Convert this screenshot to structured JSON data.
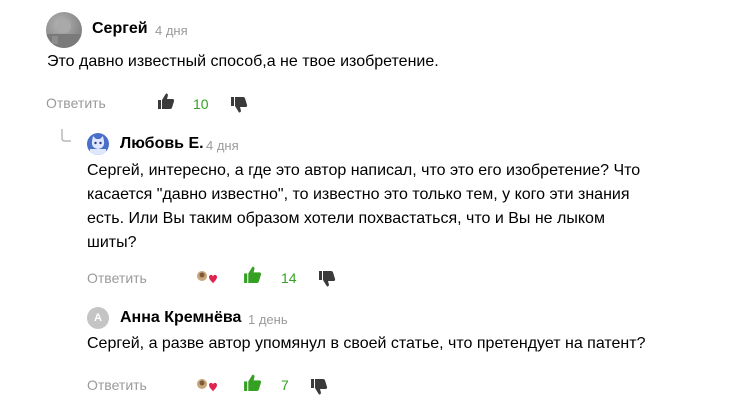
{
  "comments": [
    {
      "author": "Сергей",
      "date": "4 дня",
      "text": "Это давно известный способ,а не твое изобретение.",
      "reply_label": "Ответить",
      "likes": "10"
    },
    {
      "author": "Любовь Е.",
      "date": "4 дня",
      "text": "Сергей, интересно, а где это автор написал, что это его изобретение? Что касается \"давно известно\", то известно это только тем, у кого эти знания есть. Или Вы таким образом хотели похвастаться, что и Вы не лыком шиты?",
      "reply_label": "Ответить",
      "likes": "14"
    },
    {
      "author": "Анна Кремнёва",
      "avatar_letter": "А",
      "date": "1 день",
      "text": "Сергей, а разве автор упомянул в своей статье, что претендует на патент?",
      "reply_label": "Ответить",
      "likes": "7"
    }
  ],
  "colors": {
    "like_active": "#35a023",
    "muted_text": "#9a9a9a",
    "dislike": "#3a3a3a"
  },
  "icons": {
    "like": "thumbs-up-icon",
    "dislike": "thumbs-down-icon",
    "author_like": "author-heart-badge-icon",
    "thread": "thread-branch-icon"
  }
}
